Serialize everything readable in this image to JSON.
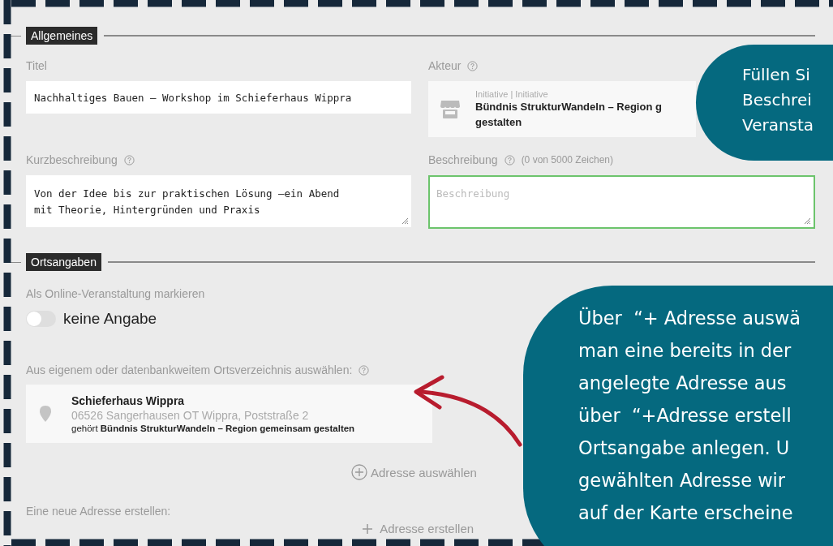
{
  "general": {
    "legend": "Allgemeines",
    "title": {
      "label": "Titel",
      "value": "Nachhaltiges Bauen – Workshop im Schieferhaus Wippra"
    },
    "actor": {
      "label": "Akteur",
      "type_line": "Initiative | Initiative",
      "name_lines": [
        "Bündnis StrukturWandeln – Region g",
        "gestalten"
      ]
    },
    "short_description": {
      "label": "Kurzbeschreibung",
      "value": "Von der Idee bis zur praktischen Lösung –ein Abend\nmit Theorie, Hintergründen und Praxis"
    },
    "description": {
      "label": "Beschreibung",
      "counter": "(0 von 5000 Zeichen)",
      "placeholder": "Beschreibung",
      "focused": true
    }
  },
  "location": {
    "legend": "Ortsangaben",
    "online": {
      "label": "Als Online-Veranstaltung markieren",
      "on": false,
      "text": "keine Angabe"
    },
    "directory": {
      "label": "Aus eigenem oder datenbankweitem Ortsverzeichnis auswählen:",
      "place": {
        "name": "Schieferhaus Wippra",
        "address": "06526 Sangerhausen OT Wippra, Poststraße 2",
        "owner": "gehört **Bündnis StrukturWandeln – Region gemeinsam gestalten**"
      },
      "select_button": "Adresse auswählen"
    },
    "new_address": {
      "label": "Eine neue Adresse erstellen:",
      "create_button": "Adresse erstellen"
    }
  },
  "callouts": [
    {
      "lines": [
        "Füllen Si",
        "Beschrei",
        "Veransta"
      ]
    },
    {
      "lines": [
        "Über  “+ Adresse auswä",
        "man eine bereits in der",
        "angelegte Adresse aus",
        "über  “+Adresse erstell",
        "Ortsangabe anlegen. U",
        "gewählten Adresse wir",
        "auf der Karte erscheine"
      ]
    }
  ]
}
